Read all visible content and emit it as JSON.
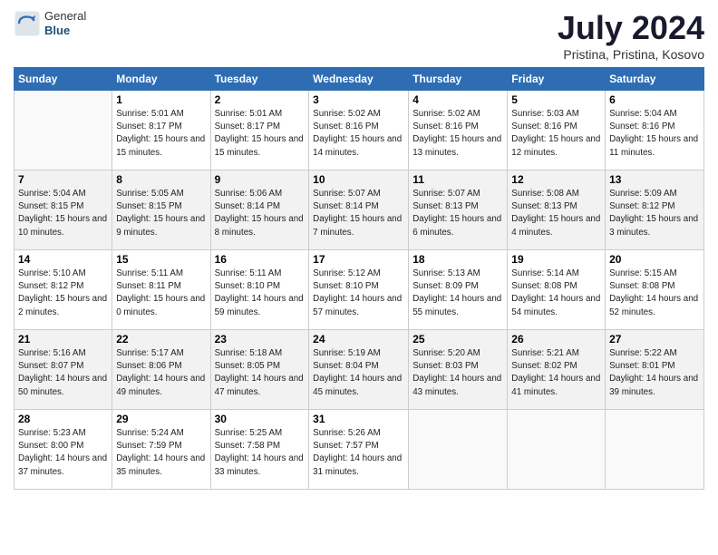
{
  "header": {
    "logo_general": "General",
    "logo_blue": "Blue",
    "month_year": "July 2024",
    "location": "Pristina, Pristina, Kosovo"
  },
  "weekdays": [
    "Sunday",
    "Monday",
    "Tuesday",
    "Wednesday",
    "Thursday",
    "Friday",
    "Saturday"
  ],
  "weeks": [
    [
      {
        "day": "",
        "sunrise": "",
        "sunset": "",
        "daylight": ""
      },
      {
        "day": "1",
        "sunrise": "Sunrise: 5:01 AM",
        "sunset": "Sunset: 8:17 PM",
        "daylight": "Daylight: 15 hours and 15 minutes."
      },
      {
        "day": "2",
        "sunrise": "Sunrise: 5:01 AM",
        "sunset": "Sunset: 8:17 PM",
        "daylight": "Daylight: 15 hours and 15 minutes."
      },
      {
        "day": "3",
        "sunrise": "Sunrise: 5:02 AM",
        "sunset": "Sunset: 8:16 PM",
        "daylight": "Daylight: 15 hours and 14 minutes."
      },
      {
        "day": "4",
        "sunrise": "Sunrise: 5:02 AM",
        "sunset": "Sunset: 8:16 PM",
        "daylight": "Daylight: 15 hours and 13 minutes."
      },
      {
        "day": "5",
        "sunrise": "Sunrise: 5:03 AM",
        "sunset": "Sunset: 8:16 PM",
        "daylight": "Daylight: 15 hours and 12 minutes."
      },
      {
        "day": "6",
        "sunrise": "Sunrise: 5:04 AM",
        "sunset": "Sunset: 8:16 PM",
        "daylight": "Daylight: 15 hours and 11 minutes."
      }
    ],
    [
      {
        "day": "7",
        "sunrise": "Sunrise: 5:04 AM",
        "sunset": "Sunset: 8:15 PM",
        "daylight": "Daylight: 15 hours and 10 minutes."
      },
      {
        "day": "8",
        "sunrise": "Sunrise: 5:05 AM",
        "sunset": "Sunset: 8:15 PM",
        "daylight": "Daylight: 15 hours and 9 minutes."
      },
      {
        "day": "9",
        "sunrise": "Sunrise: 5:06 AM",
        "sunset": "Sunset: 8:14 PM",
        "daylight": "Daylight: 15 hours and 8 minutes."
      },
      {
        "day": "10",
        "sunrise": "Sunrise: 5:07 AM",
        "sunset": "Sunset: 8:14 PM",
        "daylight": "Daylight: 15 hours and 7 minutes."
      },
      {
        "day": "11",
        "sunrise": "Sunrise: 5:07 AM",
        "sunset": "Sunset: 8:13 PM",
        "daylight": "Daylight: 15 hours and 6 minutes."
      },
      {
        "day": "12",
        "sunrise": "Sunrise: 5:08 AM",
        "sunset": "Sunset: 8:13 PM",
        "daylight": "Daylight: 15 hours and 4 minutes."
      },
      {
        "day": "13",
        "sunrise": "Sunrise: 5:09 AM",
        "sunset": "Sunset: 8:12 PM",
        "daylight": "Daylight: 15 hours and 3 minutes."
      }
    ],
    [
      {
        "day": "14",
        "sunrise": "Sunrise: 5:10 AM",
        "sunset": "Sunset: 8:12 PM",
        "daylight": "Daylight: 15 hours and 2 minutes."
      },
      {
        "day": "15",
        "sunrise": "Sunrise: 5:11 AM",
        "sunset": "Sunset: 8:11 PM",
        "daylight": "Daylight: 15 hours and 0 minutes."
      },
      {
        "day": "16",
        "sunrise": "Sunrise: 5:11 AM",
        "sunset": "Sunset: 8:10 PM",
        "daylight": "Daylight: 14 hours and 59 minutes."
      },
      {
        "day": "17",
        "sunrise": "Sunrise: 5:12 AM",
        "sunset": "Sunset: 8:10 PM",
        "daylight": "Daylight: 14 hours and 57 minutes."
      },
      {
        "day": "18",
        "sunrise": "Sunrise: 5:13 AM",
        "sunset": "Sunset: 8:09 PM",
        "daylight": "Daylight: 14 hours and 55 minutes."
      },
      {
        "day": "19",
        "sunrise": "Sunrise: 5:14 AM",
        "sunset": "Sunset: 8:08 PM",
        "daylight": "Daylight: 14 hours and 54 minutes."
      },
      {
        "day": "20",
        "sunrise": "Sunrise: 5:15 AM",
        "sunset": "Sunset: 8:08 PM",
        "daylight": "Daylight: 14 hours and 52 minutes."
      }
    ],
    [
      {
        "day": "21",
        "sunrise": "Sunrise: 5:16 AM",
        "sunset": "Sunset: 8:07 PM",
        "daylight": "Daylight: 14 hours and 50 minutes."
      },
      {
        "day": "22",
        "sunrise": "Sunrise: 5:17 AM",
        "sunset": "Sunset: 8:06 PM",
        "daylight": "Daylight: 14 hours and 49 minutes."
      },
      {
        "day": "23",
        "sunrise": "Sunrise: 5:18 AM",
        "sunset": "Sunset: 8:05 PM",
        "daylight": "Daylight: 14 hours and 47 minutes."
      },
      {
        "day": "24",
        "sunrise": "Sunrise: 5:19 AM",
        "sunset": "Sunset: 8:04 PM",
        "daylight": "Daylight: 14 hours and 45 minutes."
      },
      {
        "day": "25",
        "sunrise": "Sunrise: 5:20 AM",
        "sunset": "Sunset: 8:03 PM",
        "daylight": "Daylight: 14 hours and 43 minutes."
      },
      {
        "day": "26",
        "sunrise": "Sunrise: 5:21 AM",
        "sunset": "Sunset: 8:02 PM",
        "daylight": "Daylight: 14 hours and 41 minutes."
      },
      {
        "day": "27",
        "sunrise": "Sunrise: 5:22 AM",
        "sunset": "Sunset: 8:01 PM",
        "daylight": "Daylight: 14 hours and 39 minutes."
      }
    ],
    [
      {
        "day": "28",
        "sunrise": "Sunrise: 5:23 AM",
        "sunset": "Sunset: 8:00 PM",
        "daylight": "Daylight: 14 hours and 37 minutes."
      },
      {
        "day": "29",
        "sunrise": "Sunrise: 5:24 AM",
        "sunset": "Sunset: 7:59 PM",
        "daylight": "Daylight: 14 hours and 35 minutes."
      },
      {
        "day": "30",
        "sunrise": "Sunrise: 5:25 AM",
        "sunset": "Sunset: 7:58 PM",
        "daylight": "Daylight: 14 hours and 33 minutes."
      },
      {
        "day": "31",
        "sunrise": "Sunrise: 5:26 AM",
        "sunset": "Sunset: 7:57 PM",
        "daylight": "Daylight: 14 hours and 31 minutes."
      },
      {
        "day": "",
        "sunrise": "",
        "sunset": "",
        "daylight": ""
      },
      {
        "day": "",
        "sunrise": "",
        "sunset": "",
        "daylight": ""
      },
      {
        "day": "",
        "sunrise": "",
        "sunset": "",
        "daylight": ""
      }
    ]
  ]
}
